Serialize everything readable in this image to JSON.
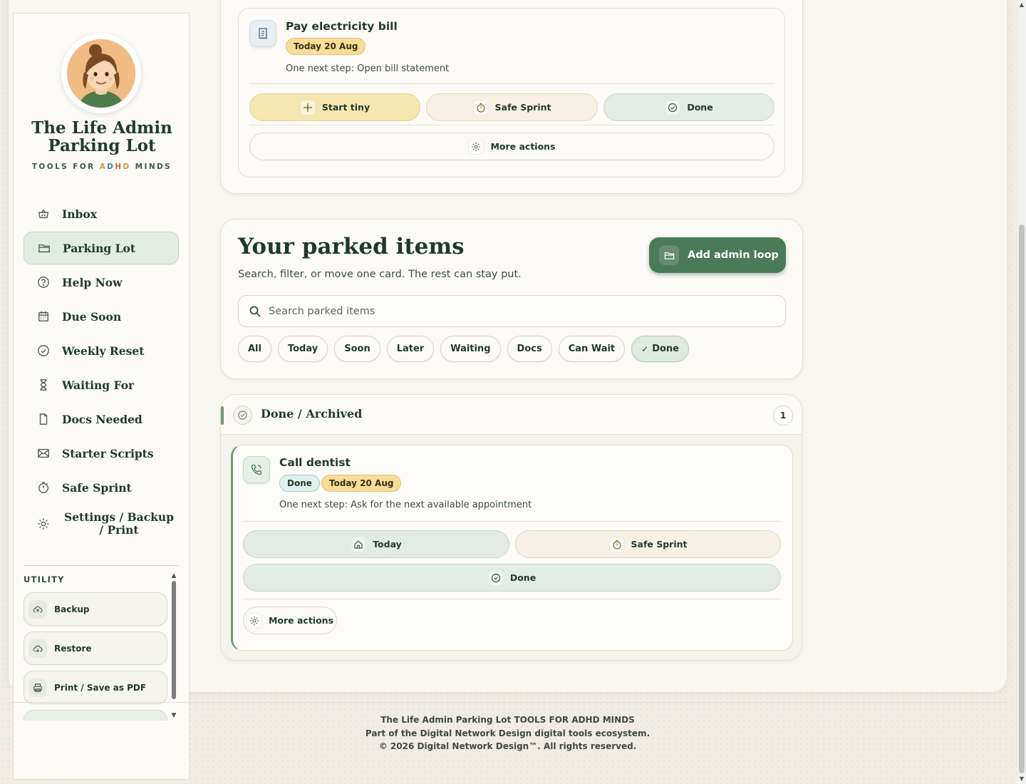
{
  "sidebar": {
    "brand_title": "The Life Admin Parking Lot",
    "brand_sub_parts": [
      "TOOLS FOR ",
      "A",
      "D",
      "H",
      "D",
      " MINDS"
    ],
    "nav": [
      {
        "label": "Inbox",
        "icon": "basket-icon"
      },
      {
        "label": "Parking Lot",
        "icon": "folder-icon"
      },
      {
        "label": "Help Now",
        "icon": "help-circle-icon"
      },
      {
        "label": "Due Soon",
        "icon": "calendar-icon"
      },
      {
        "label": "Weekly Reset",
        "icon": "check-circle-icon"
      },
      {
        "label": "Waiting For",
        "icon": "hourglass-icon"
      },
      {
        "label": "Docs Needed",
        "icon": "document-icon"
      },
      {
        "label": "Starter Scripts",
        "icon": "envelope-icon"
      },
      {
        "label": "Safe Sprint",
        "icon": "stopwatch-icon"
      },
      {
        "label": "Settings / Backup / Print",
        "icon": "gear-icon"
      }
    ],
    "active_nav": "Parking Lot",
    "utility_heading": "UTILITY",
    "utility": [
      {
        "label": "Backup",
        "icon": "cloud-upload-icon"
      },
      {
        "label": "Restore",
        "icon": "cloud-download-icon"
      },
      {
        "label": "Print / Save as PDF",
        "icon": "printer-icon"
      }
    ]
  },
  "top_task": {
    "title": "Pay electricity bill",
    "date_chip": "Today 20 Aug",
    "next_step": "One next step: Open bill statement",
    "actions": {
      "start_tiny": "Start tiny",
      "safe_sprint": "Safe Sprint",
      "done": "Done",
      "more": "More actions"
    }
  },
  "parked": {
    "title": "Your parked items",
    "subtitle": "Search, filter, or move one card. The rest can stay put.",
    "add_button": "Add admin loop",
    "search_placeholder": "Search parked items",
    "filters": [
      "All",
      "Today",
      "Soon",
      "Later",
      "Waiting",
      "Docs",
      "Can Wait",
      "Done"
    ],
    "active_filter": "Done"
  },
  "done_section": {
    "title": "Done / Archived",
    "count": "1",
    "item": {
      "title": "Call dentist",
      "status_chip": "Done",
      "date_chip": "Today 20 Aug",
      "next_step": "One next step: Ask for the next available appointment",
      "actions": {
        "today": "Today",
        "safe_sprint": "Safe Sprint",
        "done": "Done",
        "more": "More actions"
      }
    }
  },
  "footer": {
    "line1": "The Life Admin Parking Lot TOOLS FOR ADHD MINDS",
    "line2": "Part of the Digital Network Design digital tools ecosystem.",
    "line3": "© 2026 Digital Network Design™. All rights reserved."
  },
  "colors": {
    "accent_green": "#4b7a57",
    "date_yellow": "#f7dd97",
    "background": "#f1ede6"
  }
}
